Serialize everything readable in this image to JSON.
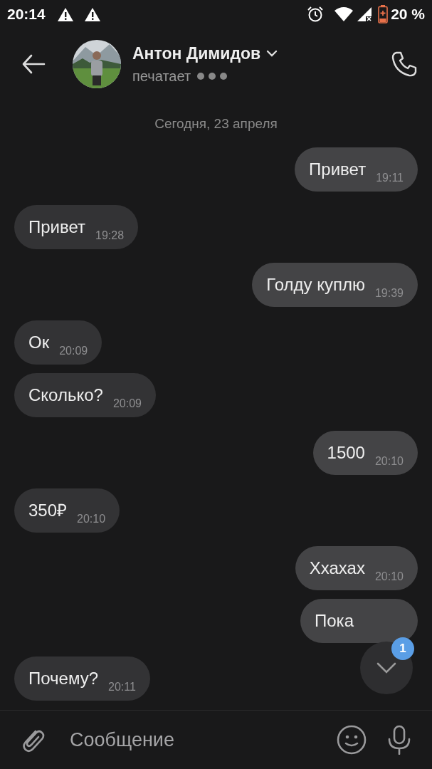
{
  "status_bar": {
    "time": "20:14",
    "battery": "20 %"
  },
  "header": {
    "name": "Антон Димидов",
    "status": "печатает"
  },
  "date_divider": "Сегодня, 23 апреля",
  "messages": [
    {
      "kind": "out",
      "text": "Привет",
      "time": "19:11"
    },
    {
      "kind": "in",
      "text": "Привет",
      "time": "19:28"
    },
    {
      "kind": "out",
      "text": "Голду куплю",
      "time": "19:39"
    },
    {
      "kind": "in",
      "text": "Ок",
      "time": "20:09"
    },
    {
      "kind": "in",
      "text": "Сколько?",
      "time": "20:09"
    },
    {
      "kind": "out",
      "text": "1500",
      "time": "20:10"
    },
    {
      "kind": "in",
      "text": "350₽",
      "time": "20:10"
    },
    {
      "kind": "out",
      "text": "Ххахах",
      "time": "20:10"
    },
    {
      "kind": "out",
      "text": "Пока"
    },
    {
      "kind": "in",
      "text": "Почему?",
      "time": "20:11"
    }
  ],
  "scroll_down_badge": "1",
  "composer": {
    "placeholder": "Сообщение"
  }
}
